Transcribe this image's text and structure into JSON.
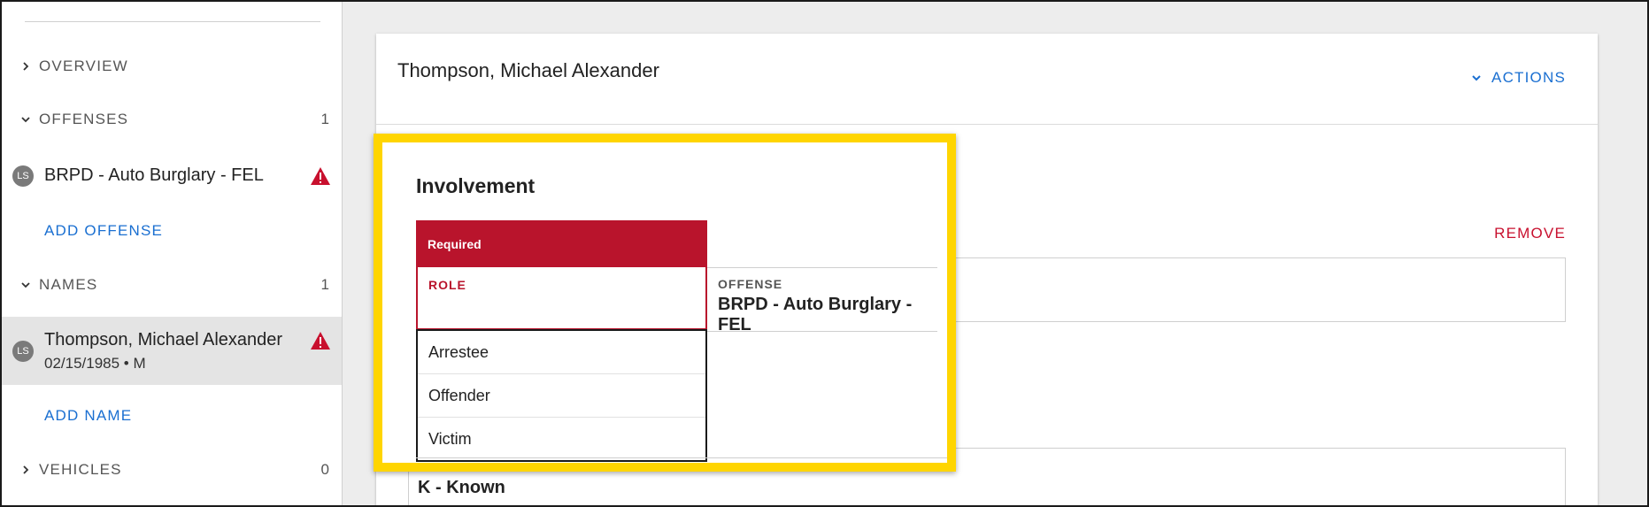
{
  "sidebar": {
    "sections": {
      "overview": {
        "label": "OVERVIEW"
      },
      "offenses": {
        "label": "OFFENSES",
        "count": "1"
      },
      "names": {
        "label": "NAMES",
        "count": "1"
      },
      "vehicles": {
        "label": "VEHICLES",
        "count": "0"
      }
    },
    "offense_item": {
      "avatar": "LS",
      "title": "BRPD - Auto Burglary - FEL",
      "warning_icon": "warning-triangle-icon"
    },
    "add_offense": "ADD OFFENSE",
    "name_item": {
      "avatar": "LS",
      "title": "Thompson, Michael Alexander",
      "subtitle": "02/15/1985 • M",
      "warning_icon": "warning-triangle-icon"
    },
    "add_name": "ADD NAME"
  },
  "card": {
    "title": "Thompson, Michael Alexander",
    "actions_label": "ACTIONS",
    "remove_label": "REMOVE",
    "known_value": "K - Known"
  },
  "involvement": {
    "title": "Involvement",
    "required_banner": "Required",
    "role_label": "ROLE",
    "offense_label": "OFFENSE",
    "offense_value": "BRPD - Auto Burglary - FEL",
    "options": [
      "Arrestee",
      "Offender",
      "Victim"
    ]
  },
  "colors": {
    "accent_blue": "#1a6fd1",
    "error_red": "#b9142c",
    "highlight_yellow": "#ffd500"
  }
}
